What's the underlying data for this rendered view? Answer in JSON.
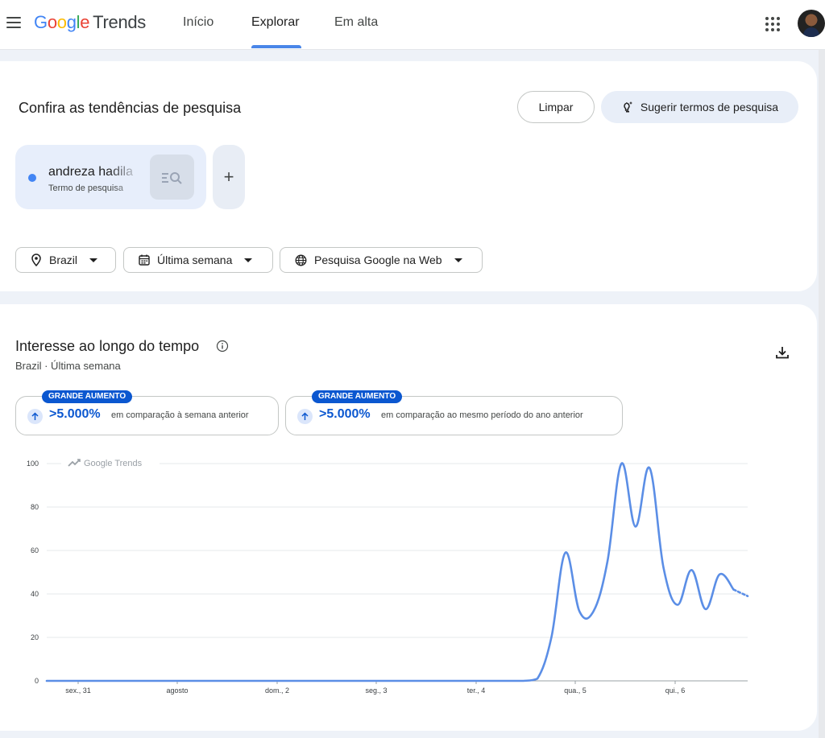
{
  "header": {
    "logo_google": "Google",
    "logo_trends": "Trends",
    "nav": {
      "inicio": "Início",
      "explorar": "Explorar",
      "em_alta": "Em alta"
    },
    "active_nav": "Explorar"
  },
  "search_panel": {
    "title": "Confira as tendências de pesquisa",
    "clear_button": "Limpar",
    "suggest_button": "Sugerir termos de pesquisa",
    "term": {
      "name": "andreza hadila",
      "type": "Termo de pesquisa",
      "color": "#4285f4"
    },
    "add_term_label": "+",
    "filters": {
      "location": "Brazil",
      "period": "Última semana",
      "property": "Pesquisa Google na Web"
    }
  },
  "interest_panel": {
    "title": "Interesse ao longo do tempo",
    "subtitle": "Brazil · Última semana",
    "insights": [
      {
        "badge": "GRANDE AUMENTO",
        "value": ">5.000%",
        "text": "em comparação à semana anterior"
      },
      {
        "badge": "GRANDE AUMENTO",
        "value": ">5.000%",
        "text": "em comparação ao mesmo período do ano anterior"
      }
    ],
    "watermark": "Google Trends"
  },
  "colors": {
    "accent": "#0b57d0",
    "series": "#5b8ee6",
    "nav_underline": "#4a86e8"
  },
  "chart_data": {
    "type": "line",
    "x_tick_labels": [
      "sex., 31",
      "agosto",
      "dom., 2",
      "seg., 3",
      "ter., 4",
      "qua., 5",
      "qui., 6"
    ],
    "y_tick_labels": [
      "0",
      "20",
      "40",
      "60",
      "80",
      "100"
    ],
    "ylim": [
      0,
      100
    ],
    "grid": true,
    "series": [
      {
        "color": "#5b8ee6",
        "x": [
          0,
          1,
          2,
          3,
          4,
          5,
          6,
          7,
          8,
          9,
          10,
          11,
          12,
          13,
          14,
          15,
          16,
          17,
          18,
          19,
          20,
          21,
          22,
          23,
          24,
          25,
          26,
          27,
          28,
          29,
          30,
          31,
          32,
          33,
          34,
          35,
          36,
          37,
          38,
          39,
          40,
          41,
          42,
          43,
          44,
          45,
          46,
          47,
          48,
          49,
          50
        ],
        "values": [
          0,
          0,
          0,
          0,
          0,
          0,
          0,
          0,
          0,
          0,
          0,
          0,
          0,
          0,
          0,
          0,
          0,
          0,
          0,
          0,
          0,
          0,
          0,
          0,
          0,
          0,
          0,
          0,
          0,
          0,
          0,
          0,
          0,
          0,
          0,
          1,
          20,
          59,
          32,
          32,
          55,
          100,
          71,
          98,
          52,
          35,
          51,
          33,
          49,
          42,
          39
        ],
        "partial_from_index": 49
      }
    ]
  }
}
